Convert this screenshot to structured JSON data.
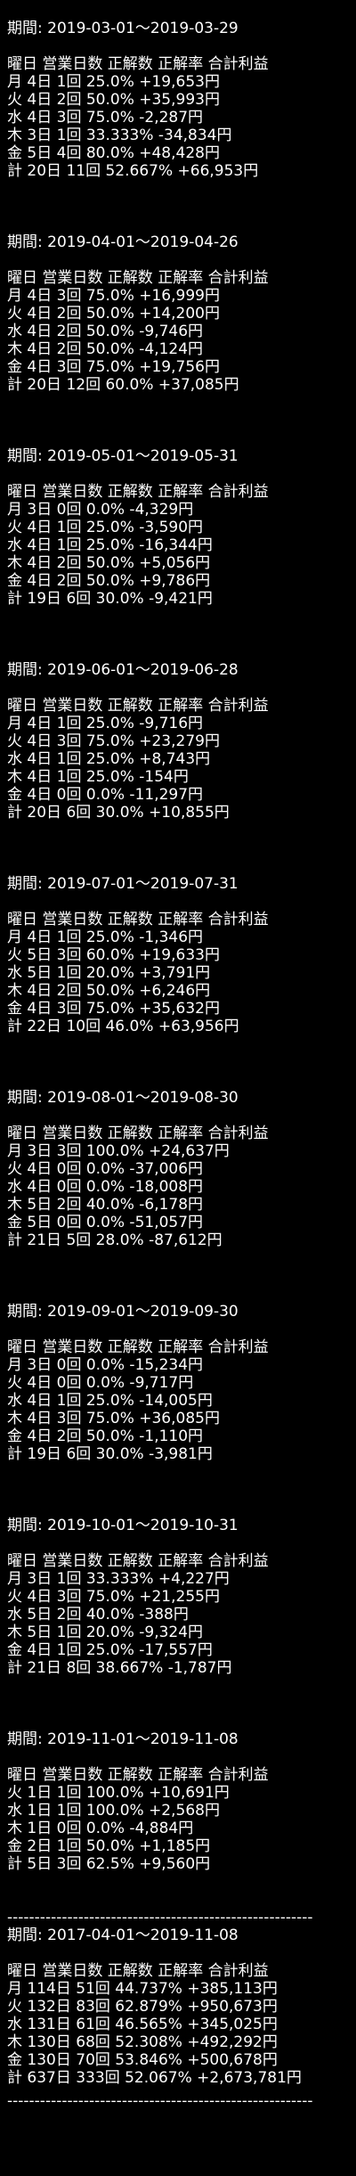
{
  "sections": [
    {
      "period": "期間: 2019-03-01～2019-03-29",
      "header": "曜日 営業日数 正解数 正解率 合計利益",
      "rows": [
        "月 4日 1回 25.0% +19,653円",
        "火 4日 2回 50.0% +35,993円",
        "水 4日 3回 75.0% -2,287円",
        "木 3日 1回 33.333% -34,834円",
        "金 5日 4回 80.0% +48,428円",
        "計 20日 11回 52.667% +66,953円"
      ]
    },
    {
      "period": "期間: 2019-04-01～2019-04-26",
      "header": "曜日 営業日数 正解数 正解率 合計利益",
      "rows": [
        "月 4日 3回 75.0% +16,999円",
        "火 4日 2回 50.0% +14,200円",
        "水 4日 2回 50.0% -9,746円",
        "木 4日 2回 50.0% -4,124円",
        "金 4日 3回 75.0% +19,756円",
        "計 20日 12回 60.0% +37,085円"
      ]
    },
    {
      "period": "期間: 2019-05-01～2019-05-31",
      "header": "曜日 営業日数 正解数 正解率 合計利益",
      "rows": [
        "月 3日 0回 0.0% -4,329円",
        "火 4日 1回 25.0% -3,590円",
        "水 4日 1回 25.0% -16,344円",
        "木 4日 2回 50.0% +5,056円",
        "金 4日 2回 50.0% +9,786円",
        "計 19日 6回 30.0% -9,421円"
      ]
    },
    {
      "period": "期間: 2019-06-01～2019-06-28",
      "header": "曜日 営業日数 正解数 正解率 合計利益",
      "rows": [
        "月 4日 1回 25.0% -9,716円",
        "火 4日 3回 75.0% +23,279円",
        "水 4日 1回 25.0% +8,743円",
        "木 4日 1回 25.0% -154円",
        "金 4日 0回 0.0% -11,297円",
        "計 20日 6回 30.0% +10,855円"
      ]
    },
    {
      "period": "期間: 2019-07-01～2019-07-31",
      "header": "曜日 営業日数 正解数 正解率 合計利益",
      "rows": [
        "月 4日 1回 25.0% -1,346円",
        "火 5日 3回 60.0% +19,633円",
        "水 5日 1回 20.0% +3,791円",
        "木 4日 2回 50.0% +6,246円",
        "金 4日 3回 75.0% +35,632円",
        "計 22日 10回 46.0% +63,956円"
      ]
    },
    {
      "period": "期間: 2019-08-01～2019-08-30",
      "header": "曜日 営業日数 正解数 正解率 合計利益",
      "rows": [
        "月 3日 3回 100.0% +24,637円",
        "火 4日 0回 0.0% -37,006円",
        "水 4日 0回 0.0% -18,008円",
        "木 5日 2回 40.0% -6,178円",
        "金 5日 0回 0.0% -51,057円",
        "計 21日 5回 28.0% -87,612円"
      ]
    },
    {
      "period": "期間: 2019-09-01～2019-09-30",
      "header": "曜日 営業日数 正解数 正解率 合計利益",
      "rows": [
        "月 3日 0回 0.0% -15,234円",
        "火 4日 0回 0.0% -9,717円",
        "水 4日 1回 25.0% -14,005円",
        "木 4日 3回 75.0% +36,085円",
        "金 4日 2回 50.0% -1,110円",
        "計 19日 6回 30.0% -3,981円"
      ]
    },
    {
      "period": "期間: 2019-10-01～2019-10-31",
      "header": "曜日 営業日数 正解数 正解率 合計利益",
      "rows": [
        "月 3日 1回 33.333% +4,227円",
        "火 4日 3回 75.0% +21,255円",
        "水 5日 2回 40.0% -388円",
        "木 5日 1回 20.0% -9,324円",
        "金 4日 1回 25.0% -17,557円",
        "計 21日 8回 38.667% -1,787円"
      ]
    },
    {
      "period": "期間: 2019-11-01～2019-11-08",
      "header": "曜日 営業日数 正解数 正解率 合計利益",
      "rows": [
        "火 1日 1回 100.0% +10,691円",
        "水 1日 1回 100.0% +2,568円",
        "木 1日 0回 0.0% -4,884円",
        "金 2日 1回 50.0% +1,185円",
        "計 5日 3回 62.5% +9,560円"
      ]
    }
  ],
  "divider": "--------------------------------------------------------",
  "summary": {
    "period": "期間: 2017-04-01～2019-11-08",
    "header": "曜日 営業日数 正解数 正解率 合計利益",
    "rows": [
      "月 114日 51回 44.737% +385,113円",
      "火 132日 83回 62.879% +950,673円",
      "水 131日 61回 46.565% +345,025円",
      "木 130日 68回 52.308% +492,292円",
      "金 130日 70回 53.846% +500,678円",
      "計 637日 333回 52.067% +2,673,781円"
    ]
  }
}
